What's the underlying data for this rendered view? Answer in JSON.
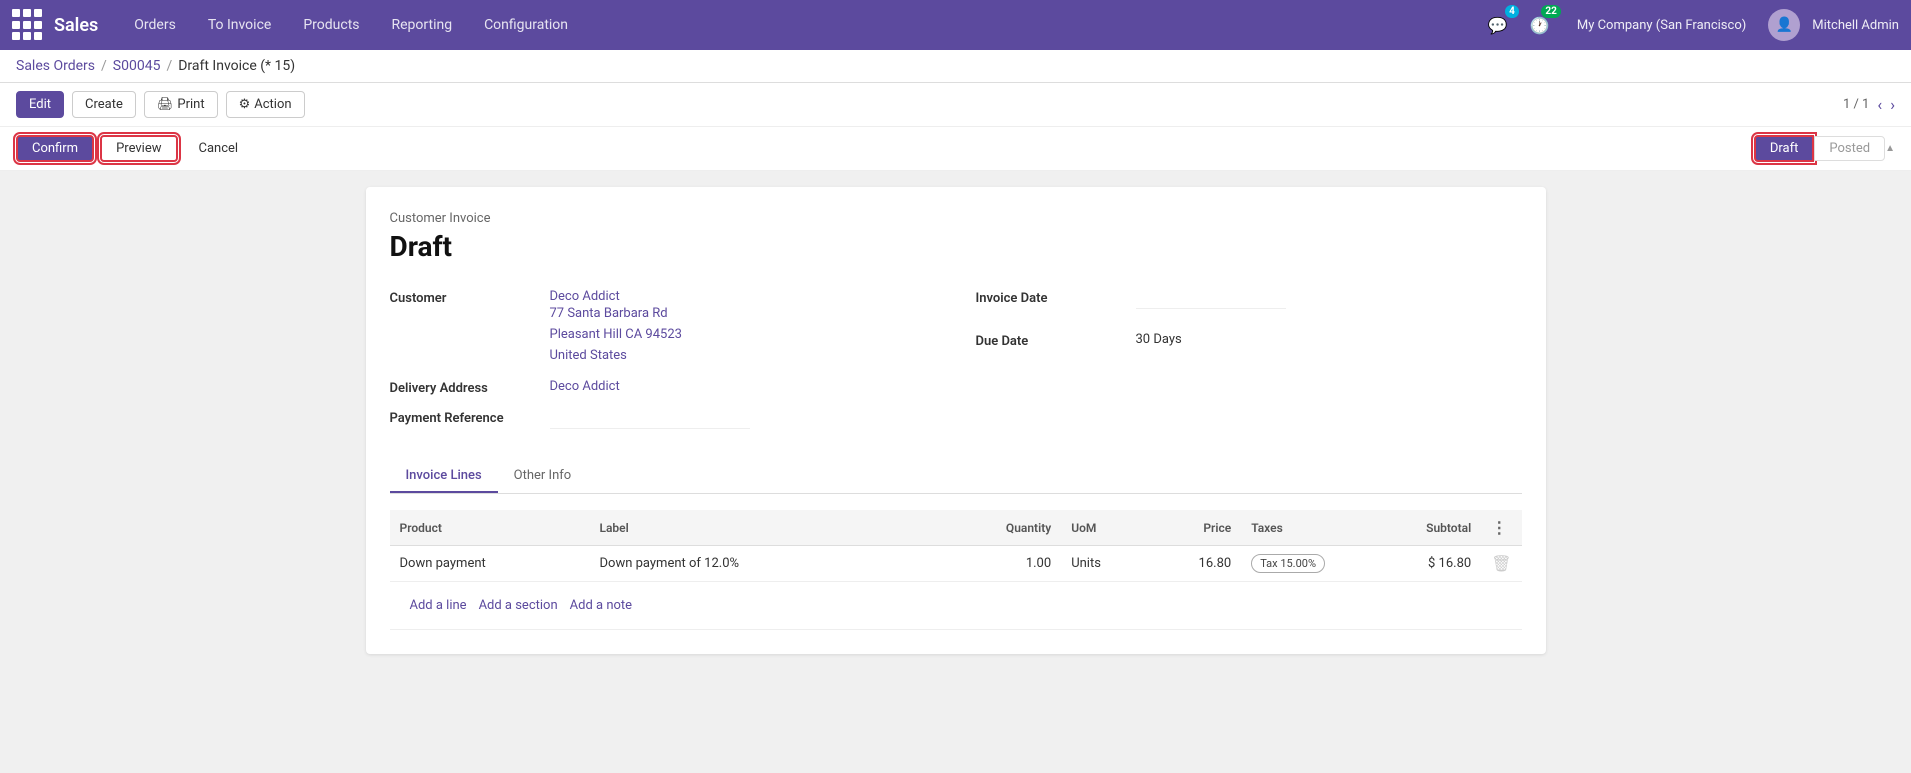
{
  "nav": {
    "app_name": "Sales",
    "items": [
      "Orders",
      "To Invoice",
      "Products",
      "Reporting",
      "Configuration"
    ],
    "company": "My Company (San Francisco)",
    "user": "Mitchell Admin",
    "badge_chat": "4",
    "badge_activity": "22"
  },
  "breadcrumb": {
    "items": [
      "Sales Orders",
      "S00045",
      "Draft Invoice (* 15)"
    ]
  },
  "toolbar": {
    "edit_label": "Edit",
    "create_label": "Create",
    "print_label": "Print",
    "action_label": "Action",
    "page_info": "1 / 1"
  },
  "status_bar": {
    "confirm_label": "Confirm",
    "preview_label": "Preview",
    "cancel_label": "Cancel",
    "draft_label": "Draft",
    "posted_label": "Posted"
  },
  "invoice": {
    "type": "Customer Invoice",
    "status": "Draft",
    "customer_label": "Customer",
    "customer_name": "Deco Addict",
    "customer_address": "77 Santa Barbara Rd\nPleasant Hill CA 94523\nUnited States",
    "delivery_address_label": "Delivery Address",
    "delivery_address": "Deco Addict",
    "payment_ref_label": "Payment Reference",
    "invoice_date_label": "Invoice Date",
    "due_date_label": "Due Date",
    "due_date_value": "30 Days",
    "tabs": [
      "Invoice Lines",
      "Other Info"
    ],
    "active_tab": "Invoice Lines",
    "table": {
      "headers": [
        "Product",
        "Label",
        "Quantity",
        "UoM",
        "Price",
        "Taxes",
        "Subtotal",
        ""
      ],
      "rows": [
        {
          "product": "Down payment",
          "label": "Down payment of 12.0%",
          "quantity": "1.00",
          "uom": "Units",
          "price": "16.80",
          "taxes": "Tax 15.00%",
          "subtotal": "$ 16.80"
        }
      ],
      "add_line": "Add a line",
      "add_section": "Add a section",
      "add_note": "Add a note"
    }
  }
}
